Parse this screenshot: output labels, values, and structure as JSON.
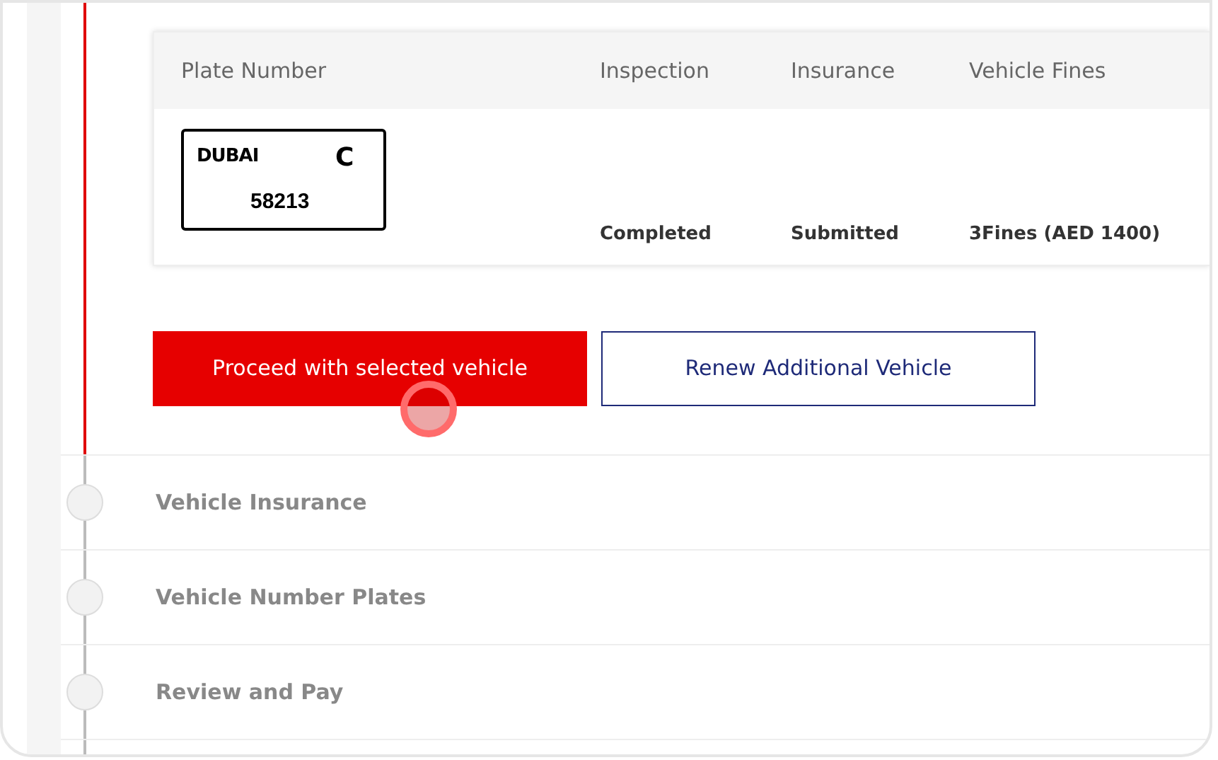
{
  "vehicle_table": {
    "columns": [
      "Plate Number",
      "Inspection",
      "Insurance",
      "Vehicle Fines"
    ],
    "rows": [
      {
        "plate": {
          "emirate": "DUBAI",
          "code": "C",
          "number": "58213"
        },
        "inspection": "Completed",
        "insurance": "Submitted",
        "fines": "3Fines (AED 1400)"
      }
    ]
  },
  "buttons": [
    {
      "label": "Proceed with selected vehicle",
      "kind": "primary",
      "clicked": true
    },
    {
      "label": "Renew Additional Vehicle",
      "kind": "secondary",
      "clicked": false
    }
  ],
  "steps": [
    {
      "label": "Vehicle Insurance"
    },
    {
      "label": "Vehicle Number Plates"
    },
    {
      "label": "Review and Pay"
    }
  ]
}
